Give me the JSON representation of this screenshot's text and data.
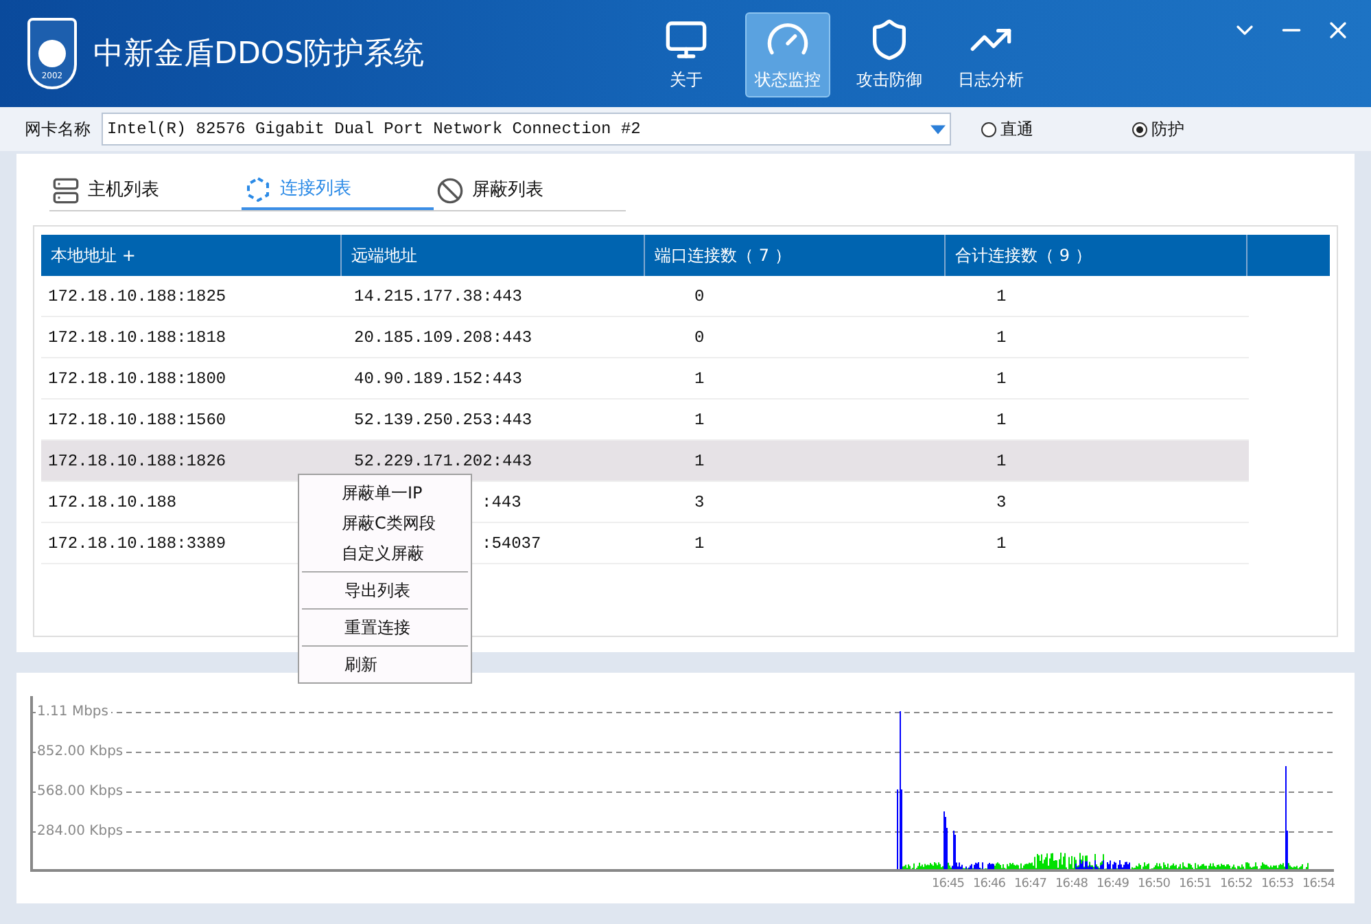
{
  "window": {
    "title": "中新金盾DDOS防护系统",
    "logo_year": "2002"
  },
  "nav": [
    {
      "label": "关于",
      "kind": "about",
      "selected": false
    },
    {
      "label": "状态监控",
      "kind": "monitor",
      "selected": true
    },
    {
      "label": "攻击防御",
      "kind": "defense",
      "selected": false
    },
    {
      "label": "日志分析",
      "kind": "log",
      "selected": false
    }
  ],
  "nic": {
    "label": "网卡名称",
    "value": "Intel(R) 82576 Gigabit Dual Port Network Connection #2"
  },
  "modes": [
    {
      "label": "直通",
      "selected": false
    },
    {
      "label": "防护",
      "selected": true
    }
  ],
  "tabs": [
    {
      "label": "主机列表",
      "kind": "host",
      "selected": false
    },
    {
      "label": "连接列表",
      "kind": "connection",
      "selected": true
    },
    {
      "label": "屏蔽列表",
      "kind": "block",
      "selected": false
    }
  ],
  "table": {
    "columns": [
      "本地地址 +",
      "远端地址",
      "端口连接数（ 7 ）",
      "合计连接数（ 9 ）"
    ],
    "rows": [
      {
        "local": "172.18.10.188:1825",
        "remote": "14.215.177.38:443",
        "port_count": "0",
        "total": "1",
        "selected": false,
        "partly_hidden": false
      },
      {
        "local": "172.18.10.188:1818",
        "remote": "20.185.109.208:443",
        "port_count": "0",
        "total": "1",
        "selected": false,
        "partly_hidden": false
      },
      {
        "local": "172.18.10.188:1800",
        "remote": "40.90.189.152:443",
        "port_count": "1",
        "total": "1",
        "selected": false,
        "partly_hidden": false
      },
      {
        "local": "172.18.10.188:1560",
        "remote": "52.139.250.253:443",
        "port_count": "1",
        "total": "1",
        "selected": false,
        "partly_hidden": false
      },
      {
        "local": "172.18.10.188:1826",
        "remote": "52.229.171.202:443",
        "port_count": "1",
        "total": "1",
        "selected": true,
        "partly_hidden": false
      },
      {
        "local": "172.18.10.188",
        "remote": ":443",
        "port_count": "3",
        "total": "3",
        "selected": false,
        "partly_hidden": true
      },
      {
        "local": "172.18.10.188:3389",
        "remote": ":54037",
        "port_count": "1",
        "total": "1",
        "selected": false,
        "partly_hidden": true
      }
    ]
  },
  "context_menu": {
    "groups": [
      [
        "屏蔽单一IP",
        "屏蔽C类网段",
        "自定义屏蔽"
      ],
      [
        "导出列表"
      ],
      [
        "重置连接"
      ],
      [
        "刷新"
      ]
    ]
  },
  "traffic_chart": {
    "y_labels": [
      "1.11 Mbps",
      "852.00 Kbps",
      "568.00 Kbps",
      "284.00 Kbps"
    ],
    "x_labels": [
      "16:45",
      "16:46",
      "16:47",
      "16:48",
      "16:49",
      "16:50",
      "16:51",
      "16:52",
      "16:53",
      "16:54"
    ]
  }
}
